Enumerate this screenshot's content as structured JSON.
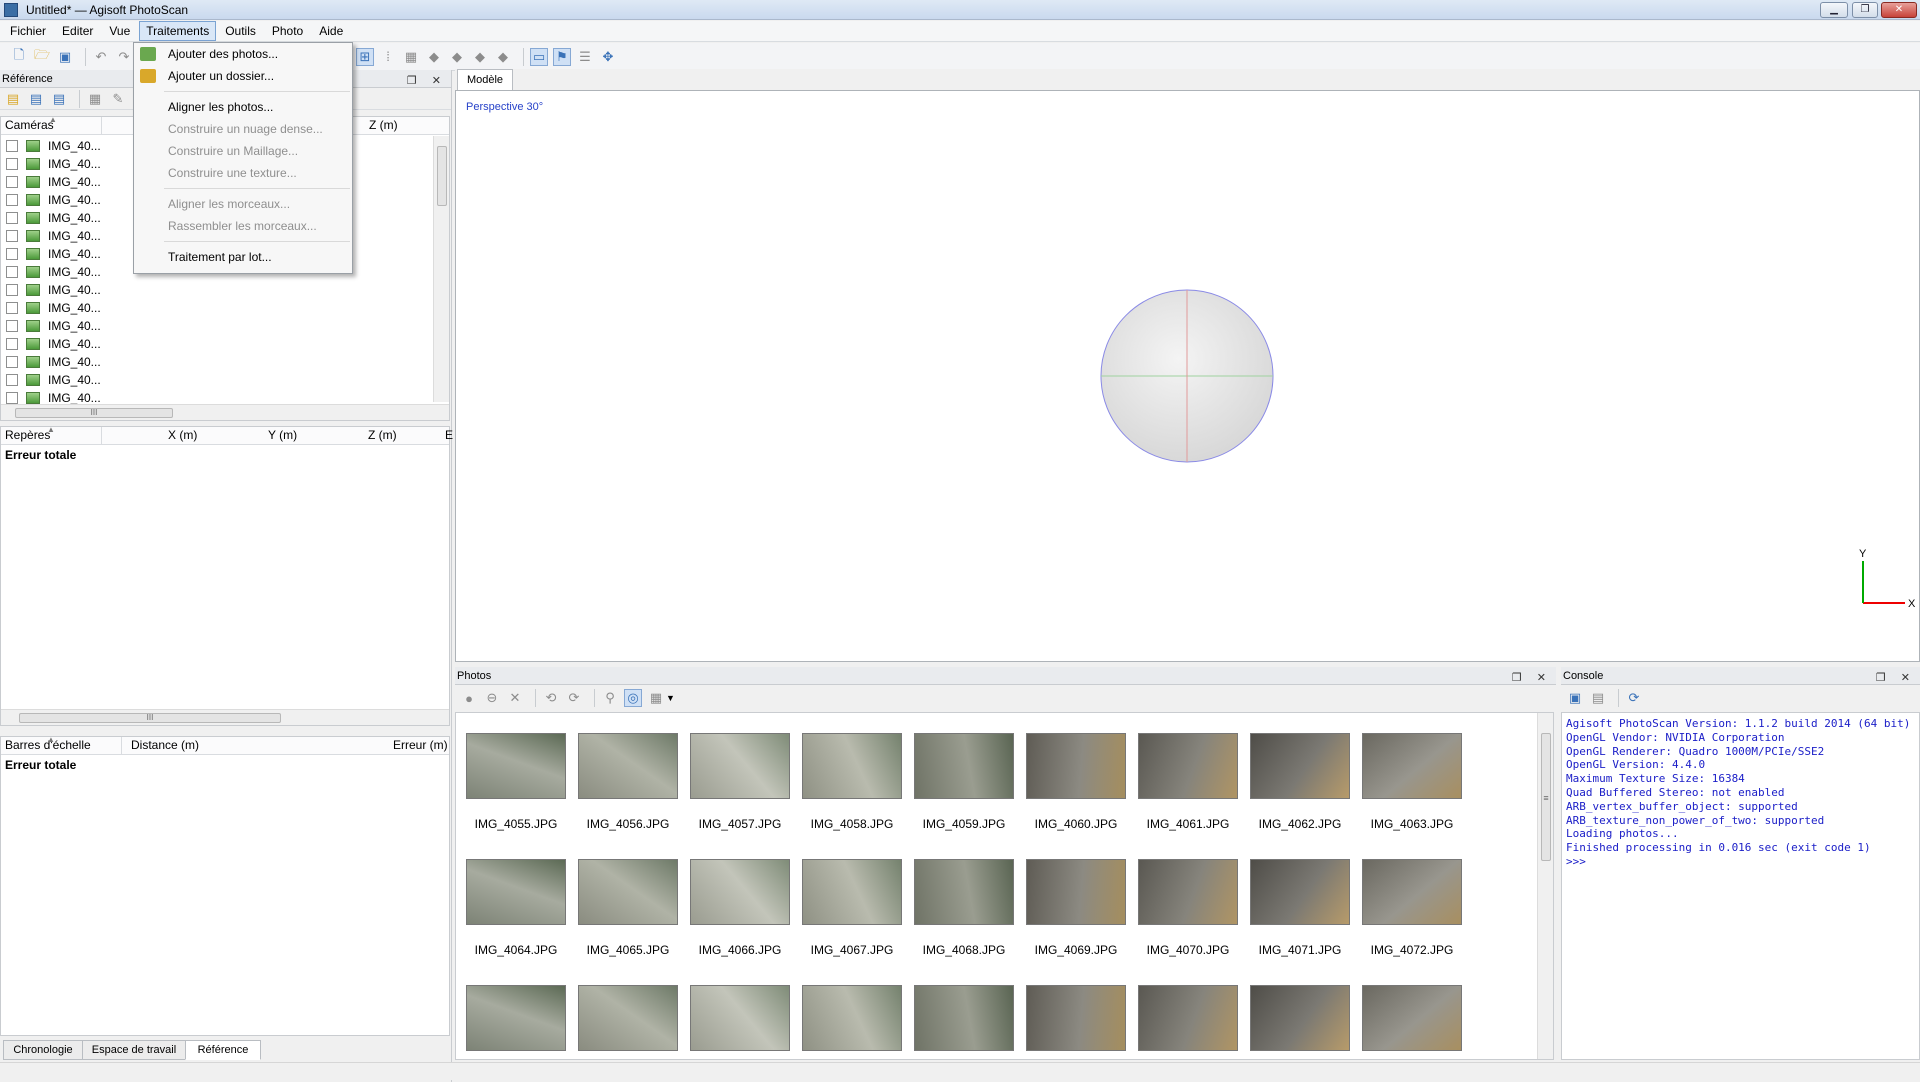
{
  "window": {
    "title": "Untitled* — Agisoft PhotoScan",
    "minimize": "▁",
    "maximize": "❐",
    "close": "✕"
  },
  "menubar": [
    "Fichier",
    "Editer",
    "Vue",
    "Traitements",
    "Outils",
    "Photo",
    "Aide"
  ],
  "menu_active": "Traitements",
  "dropdown": {
    "items": [
      {
        "label": "Ajouter des photos...",
        "enabled": true
      },
      {
        "label": "Ajouter un dossier...",
        "enabled": true
      },
      {
        "label": "Aligner les photos...",
        "enabled": true
      },
      {
        "label": "Construire un nuage dense...",
        "enabled": false
      },
      {
        "label": "Construire un Maillage...",
        "enabled": false
      },
      {
        "label": "Construire une texture...",
        "enabled": false
      },
      {
        "label": "Aligner les morceaux...",
        "enabled": false
      },
      {
        "label": "Rassembler les morceaux...",
        "enabled": false
      },
      {
        "label": "Traitement par lot...",
        "enabled": true
      }
    ]
  },
  "reference_panel": {
    "title": "Référence",
    "cameras_header": {
      "col1": "Caméras",
      "col_z": "Z (m)"
    },
    "cameras": [
      "IMG_40...",
      "IMG_40...",
      "IMG_40...",
      "IMG_40...",
      "IMG_40...",
      "IMG_40...",
      "IMG_40...",
      "IMG_40...",
      "IMG_40...",
      "IMG_40...",
      "IMG_40...",
      "IMG_40...",
      "IMG_40...",
      "IMG_40...",
      "IMG_40..."
    ],
    "markers_header": {
      "col1": "Repères",
      "col_x": "X (m)",
      "col_y": "Y (m)",
      "col_z": "Z (m)",
      "col_e": "E"
    },
    "markers_total": "Erreur totale",
    "scalebars_header": {
      "col1": "Barres d'échelle",
      "col_dist": "Distance (m)",
      "col_err": "Erreur (m)"
    },
    "scalebars_total": "Erreur totale",
    "scroll_glyph": "III"
  },
  "bottom_tabs": [
    "Chronologie",
    "Espace de travail",
    "Référence"
  ],
  "bottom_tab_selected": "Référence",
  "model_view": {
    "tab": "Modèle",
    "projection": "Perspective 30°",
    "axis_y": "Y",
    "axis_x": "X"
  },
  "photos_panel": {
    "title": "Photos",
    "photos": [
      "IMG_4055.JPG",
      "IMG_4056.JPG",
      "IMG_4057.JPG",
      "IMG_4058.JPG",
      "IMG_4059.JPG",
      "IMG_4060.JPG",
      "IMG_4061.JPG",
      "IMG_4062.JPG",
      "IMG_4063.JPG",
      "IMG_4064.JPG",
      "IMG_4065.JPG",
      "IMG_4066.JPG",
      "IMG_4067.JPG",
      "IMG_4068.JPG",
      "IMG_4069.JPG",
      "IMG_4070.JPG",
      "IMG_4071.JPG",
      "IMG_4072.JPG"
    ],
    "scroll_glyph": "≡"
  },
  "console_panel": {
    "title": "Console",
    "text": "Agisoft PhotoScan Version: 1.1.2 build 2014 (64 bit)\nOpenGL Vendor: NVIDIA Corporation\nOpenGL Renderer: Quadro 1000M/PCIe/SSE2\nOpenGL Version: 4.4.0\nMaximum Texture Size: 16384\nQuad Buffered Stereo: not enabled\nARB_vertex_buffer_object: supported\nARB_texture_non_power_of_two: supported\nLoading photos...\nFinished processing in 0.016 sec (exit code 1)\n>>>"
  },
  "panel_buttons": "❐ ✕"
}
